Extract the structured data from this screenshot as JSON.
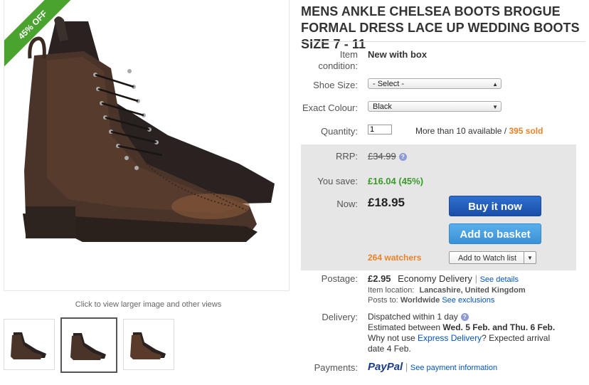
{
  "gallery": {
    "badge": "45% OFF",
    "caption": "Click to view larger image and other views",
    "thumbs": [
      "thumb-1",
      "thumb-2",
      "thumb-3"
    ],
    "active_thumb": 2
  },
  "listing": {
    "title": "MENS ANKLE CHELSEA BOOTS BROGUE FORMAL DRESS LACE UP WEDDING BOOTS SIZE 7 - 11",
    "condition_label": "Item condition:",
    "condition_value": "New with box",
    "shoe_size_label": "Shoe Size:",
    "shoe_size_value": "- Select -",
    "colour_label": "Exact Colour:",
    "colour_value": "Black",
    "quantity_label": "Quantity:",
    "quantity_value": "1",
    "available_text": "More than 10 available /",
    "sold_text": "395 sold"
  },
  "price": {
    "rrp_label": "RRP:",
    "rrp_value": "£34.99",
    "save_label": "You save:",
    "save_value": "£16.04 (45%)",
    "now_label": "Now:",
    "now_value": "£18.95",
    "buy_label": "Buy it now",
    "basket_label": "Add to basket",
    "watchers": "264 watchers",
    "watch_label": "Add to Watch list"
  },
  "postage": {
    "label": "Postage:",
    "amount": "£2.95",
    "service": "Economy Delivery",
    "details_link": "See details",
    "location_label": "Item location:",
    "location_value": "Lancashire, United Kingdom",
    "posts_label": "Posts to:",
    "posts_value": "Worldwide",
    "exclusions_link": "See exclusions"
  },
  "delivery": {
    "label": "Delivery:",
    "dispatch": "Dispatched within 1 day",
    "estimated_prefix": "Estimated between",
    "estimated_dates": "Wed. 5 Feb. and Thu. 6 Feb.",
    "why_prefix": "Why not use",
    "express_link": "Express Delivery",
    "why_suffix": "? Expected arrival",
    "arrival": "date 4 Feb."
  },
  "payments": {
    "label": "Payments:",
    "paypal": "PayPal",
    "link": "See payment information"
  },
  "colors": {
    "accent_green": "#4aa22f",
    "sold_orange": "#e8832a",
    "save_green": "#3a9a2a",
    "link_blue": "#0654ba",
    "buy_blue": "#1a4ea8",
    "basket_blue": "#3a90d6"
  }
}
